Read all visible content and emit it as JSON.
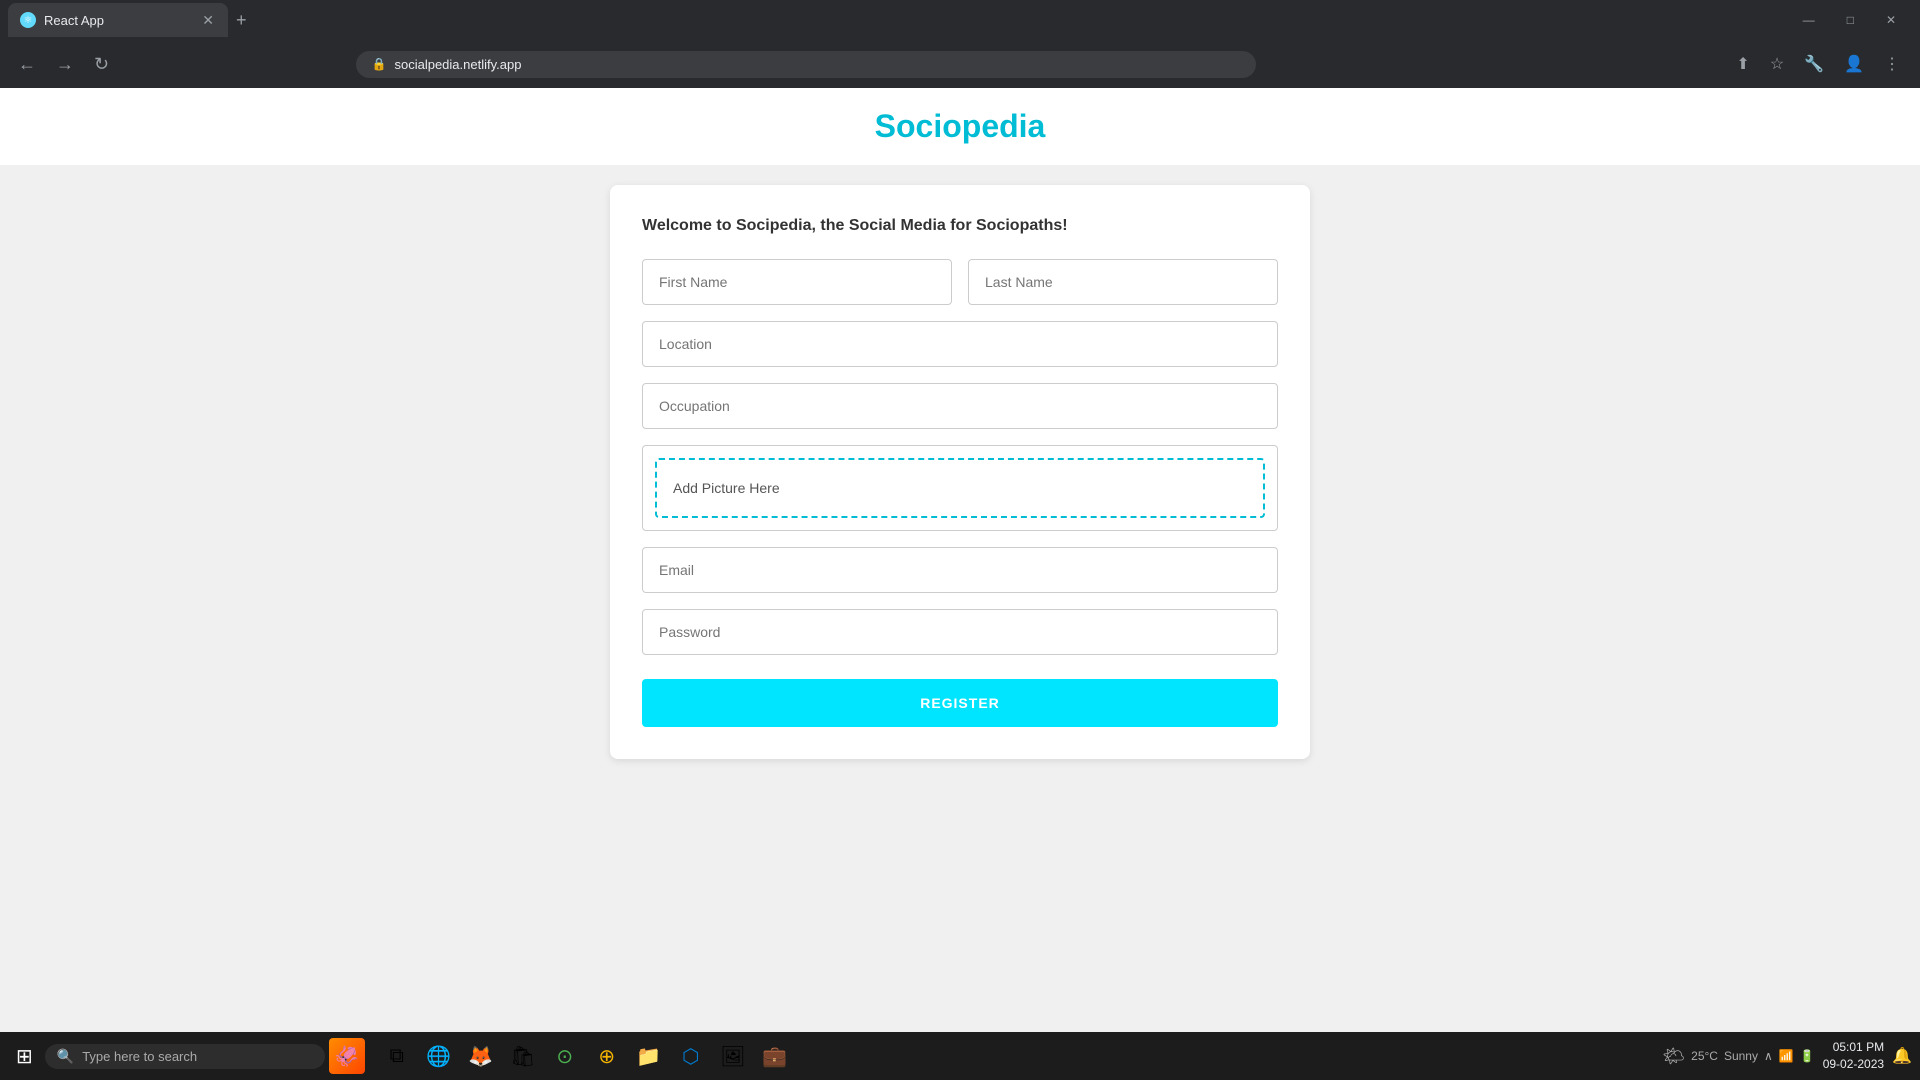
{
  "browser": {
    "tab_title": "React App",
    "tab_favicon": "⚛",
    "address": "socialpedia.netlify.app",
    "address_lock": "🔒",
    "new_tab_icon": "+",
    "back_icon": "←",
    "forward_icon": "→",
    "refresh_icon": "↻",
    "window_minimize": "—",
    "window_maximize": "□",
    "window_close": "✕"
  },
  "page": {
    "site_title": "Sociopedia",
    "welcome_message": "Welcome to Socipedia, the Social Media for Sociopaths!",
    "form": {
      "first_name_placeholder": "First Name",
      "last_name_placeholder": "Last Name",
      "location_placeholder": "Location",
      "occupation_placeholder": "Occupation",
      "picture_label": "Add Picture Here",
      "email_placeholder": "Email",
      "password_placeholder": "Password",
      "register_label": "REGISTER"
    }
  },
  "taskbar": {
    "start_icon": "⊞",
    "search_placeholder": "Type here to search",
    "search_icon": "🔍",
    "apps": [
      {
        "name": "task-view",
        "icon": "⧉"
      },
      {
        "name": "edge",
        "icon": "🌐"
      },
      {
        "name": "firefox",
        "icon": "🦊"
      },
      {
        "name": "microsoft-store",
        "icon": "🛍"
      },
      {
        "name": "chrome",
        "icon": "⊙"
      },
      {
        "name": "chrome-alt",
        "icon": "⊕"
      },
      {
        "name": "file-manager",
        "icon": "📁"
      },
      {
        "name": "vscode",
        "icon": "⬡"
      },
      {
        "name": "photos",
        "icon": "🖼"
      },
      {
        "name": "app9",
        "icon": "💼"
      }
    ],
    "system_tray": {
      "weather_icon": "🌤",
      "temperature": "25°C",
      "condition": "Sunny",
      "network_icon": "📶",
      "notification_icon": "🔔"
    },
    "clock": {
      "time": "05:01 PM",
      "date": "09-02-2023"
    }
  }
}
